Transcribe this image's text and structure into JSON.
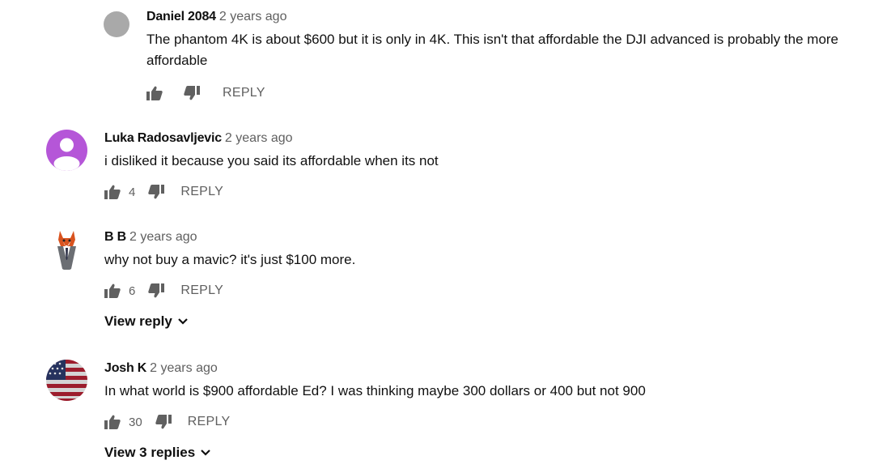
{
  "comments": [
    {
      "author": "Daniel 2084",
      "time": "2 years ago",
      "text": "The phantom 4K is about $600 but it is only in 4K. This isn't that affordable the DJI advanced is probably the more affordable",
      "likes": "",
      "reply_label": "REPLY",
      "avatar": "gray-circle",
      "avatar_color": "#a9a9a9"
    },
    {
      "author": "Luka Radosavljevic",
      "time": "2 years ago",
      "text": "i disliked it because you said its affordable when its not",
      "likes": "4",
      "reply_label": "REPLY",
      "avatar": "default-user-icon",
      "avatar_color": "#b556d8"
    },
    {
      "author": "B B",
      "time": "2 years ago",
      "text": "why not buy a mavic? it's just $100 more.",
      "likes": "6",
      "reply_label": "REPLY",
      "avatar": "fox-in-suit",
      "view_replies": "View reply"
    },
    {
      "author": "Josh K",
      "time": "2 years ago",
      "text": "In what world is $900 affordable Ed? I was thinking maybe 300 dollars or 400 but not 900",
      "likes": "30",
      "reply_label": "REPLY",
      "avatar": "us-flag",
      "view_replies": "View 3 replies"
    }
  ],
  "icons": {
    "like": "thumbs-up-icon",
    "dislike": "thumbs-down-icon",
    "expand": "chevron-down-icon"
  }
}
